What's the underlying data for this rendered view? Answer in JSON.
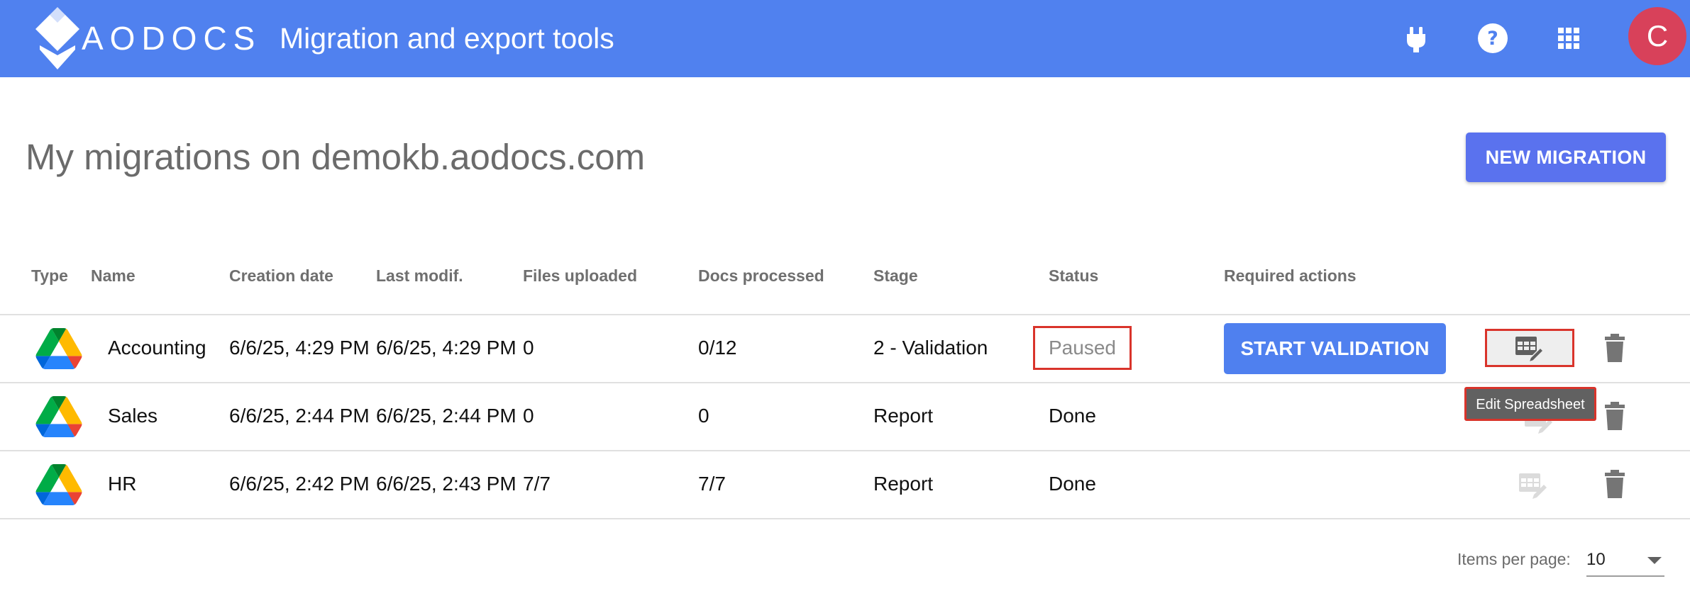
{
  "header": {
    "brand": "AODOCS",
    "title": "Migration and export tools",
    "avatar_letter": "C",
    "icons": [
      "plug-icon",
      "help-icon",
      "apps-grid-icon"
    ]
  },
  "page": {
    "title": "My migrations on demokb.aodocs.com",
    "new_button": "NEW MIGRATION"
  },
  "table": {
    "columns": {
      "type": "Type",
      "name": "Name",
      "creation": "Creation date",
      "modified": "Last modif.",
      "files": "Files uploaded",
      "docs": "Docs processed",
      "stage": "Stage",
      "status": "Status",
      "actions": "Required actions"
    },
    "rows": [
      {
        "type_icon": "google-drive-icon",
        "name": "Accounting",
        "creation": "6/6/25, 4:29 PM",
        "modified": "6/6/25, 4:29 PM",
        "files": "0",
        "docs": "0/12",
        "stage": "2 - Validation",
        "status": "Paused",
        "action": "START VALIDATION"
      },
      {
        "type_icon": "google-drive-icon",
        "name": "Sales",
        "creation": "6/6/25, 2:44 PM",
        "modified": "6/6/25, 2:44 PM",
        "files": "0",
        "docs": "0",
        "stage": "Report",
        "status": "Done",
        "action": ""
      },
      {
        "type_icon": "google-drive-icon",
        "name": "HR",
        "creation": "6/6/25, 2:42 PM",
        "modified": "6/6/25, 2:43 PM",
        "files": "7/7",
        "docs": "7/7",
        "stage": "Report",
        "status": "Done",
        "action": ""
      }
    ],
    "tooltip": "Edit Spreadsheet"
  },
  "paginator": {
    "label": "Items per page:",
    "value": "10"
  },
  "colors": {
    "header_bg": "#5081ef",
    "primary_button": "#4f80ef",
    "new_button": "#5a72ee",
    "avatar": "#d8415a",
    "highlight": "#d9342b"
  }
}
